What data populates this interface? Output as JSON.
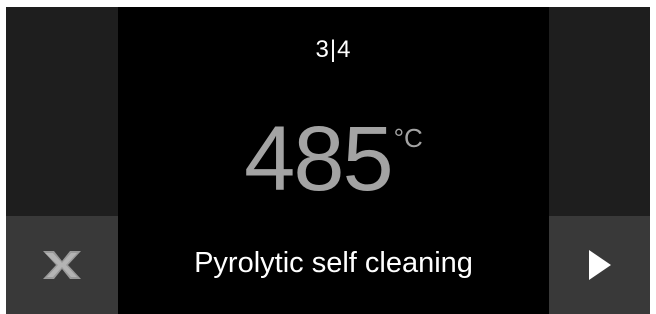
{
  "display": {
    "step_indicator": "3|4",
    "temperature_value": "485",
    "temperature_unit": "°C",
    "program_name": "Pyrolytic self cleaning"
  },
  "buttons": {
    "cancel_icon": "close-x-icon",
    "next_icon": "play-arrow-right-icon"
  },
  "colors": {
    "screen_background": "#000000",
    "side_panel": "#1e1e1e",
    "button_background": "#393939",
    "temperature_text": "#a3a3a3",
    "primary_text": "#ffffff"
  }
}
